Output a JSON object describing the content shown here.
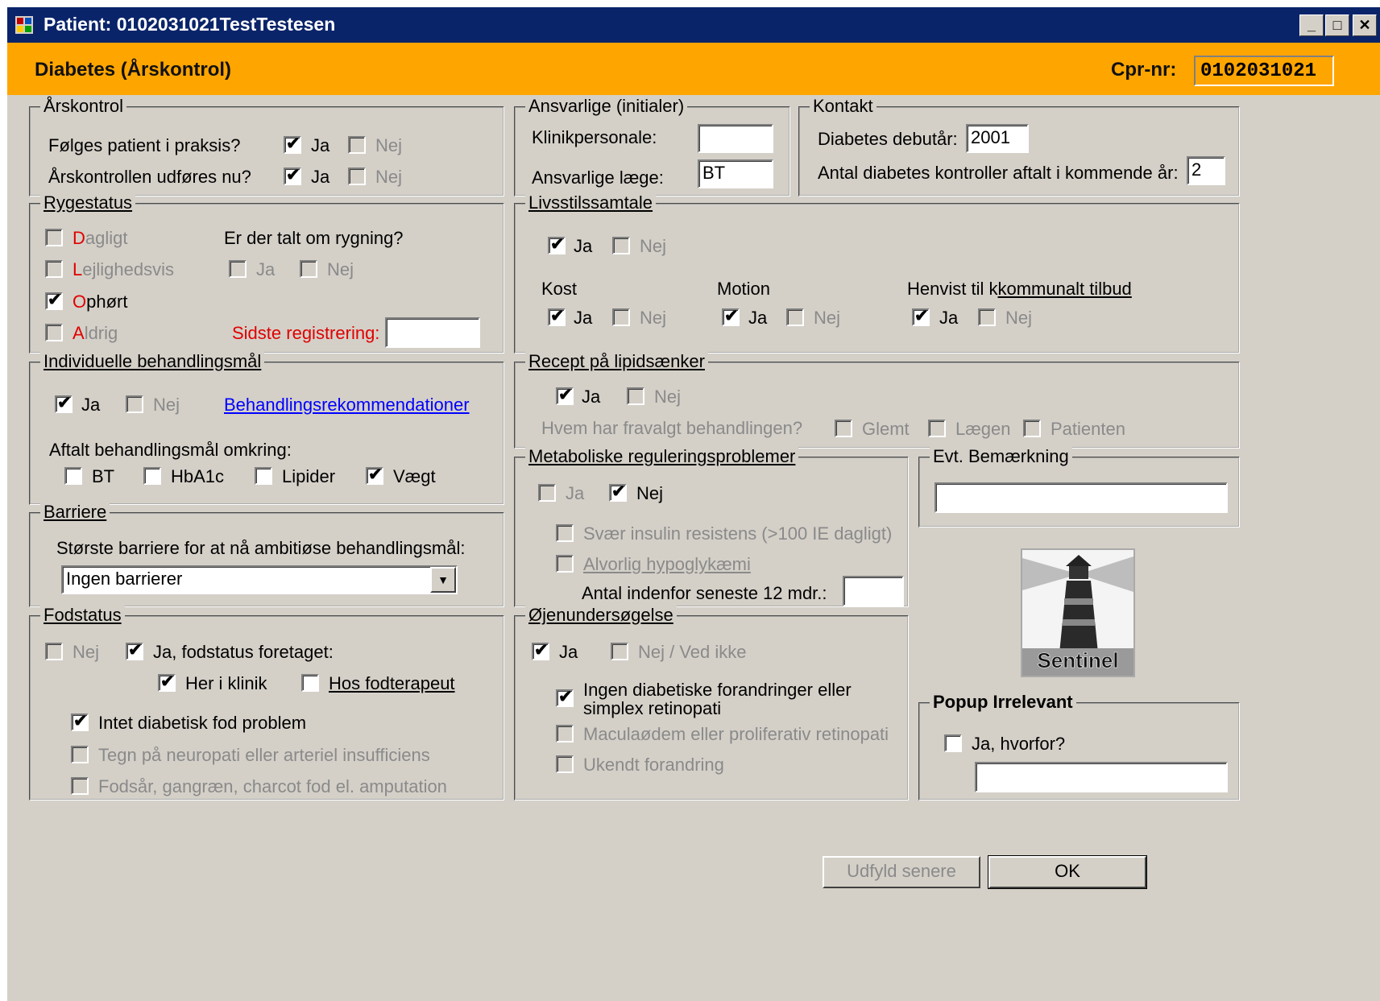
{
  "window": {
    "title": "Patient: 0102031021TestTestesen",
    "min_label": "_",
    "max_label": "□",
    "close_label": "✕"
  },
  "header": {
    "form_title": "Diabetes (Årskontrol)",
    "cpr_label": "Cpr-nr:",
    "cpr_value": "0102031021",
    "bg_color": "#ffa500"
  },
  "aarskontrol": {
    "legend": "Årskontrol",
    "q1": "Følges patient i praksis?",
    "q2": "Årskontrollen udføres nu?",
    "ja": "Ja",
    "nej": "Nej"
  },
  "ansvarlige": {
    "legend": "Ansvarlige (initialer)",
    "klinik_label": "Klinikpersonale:",
    "klinik_value": "",
    "laege_label": "Ansvarlige læge:",
    "laege_value": "BT"
  },
  "kontakt": {
    "legend": "Kontakt",
    "debut_label": "Diabetes debutår:",
    "debut_value": "2001",
    "antal_label": "Antal diabetes kontroller aftalt i kommende år:",
    "antal_value": "2"
  },
  "rygestatus": {
    "legend": "Rygestatus",
    "opt1_first": "D",
    "opt1_rest": "agligt",
    "opt2_first": "L",
    "opt2_rest": "ejlighedsvis",
    "opt3_first": "O",
    "opt3_rest": "phørt",
    "opt4_first": "A",
    "opt4_rest": "ldrig",
    "talt_label": "Er der talt om rygning?",
    "ja": "Ja",
    "nej": "Nej",
    "sidste_label": "Sidste registrering:",
    "sidste_value": ""
  },
  "livsstil": {
    "legend": "Livsstilssamtale",
    "ja": "Ja",
    "nej": "Nej",
    "kost": "Kost",
    "motion": "Motion",
    "henvist_prefix": "Henvist til k",
    "henvist_link": "kommunalt tilbud"
  },
  "behandling": {
    "legend": "Individuelle behandlingsmål",
    "ja": "Ja",
    "nej": "Nej",
    "link": "Behandlingsrekommendationer",
    "aftalt_label": "Aftalt behandlingsmål omkring:",
    "bt": "BT",
    "hba1c": "HbA1c",
    "lipider": "Lipider",
    "vaegt": "Vægt"
  },
  "recept": {
    "legend": "Recept på lipidsænker",
    "ja": "Ja",
    "nej": "Nej",
    "hvem_label": "Hvem har fravalgt behandlingen?",
    "glemt": "Glemt",
    "laegen": "Lægen",
    "patienten": "Patienten"
  },
  "barriere": {
    "legend": "Barriere",
    "label": "Største barriere for at nå ambitiøse behandlingsmål:",
    "selected": "Ingen barrierer"
  },
  "metabolisk": {
    "legend": "Metaboliske reguleringsproblemer",
    "ja": "Ja",
    "nej": "Nej",
    "insulin": "Svær insulin resistens (>100 IE dagligt)",
    "hypo": "Alvorlig hypoglykæmi",
    "antal_label": "Antal indenfor seneste 12 mdr.:",
    "antal_value": ""
  },
  "bemaerkning": {
    "legend": "Evt. Bemærkning",
    "value": ""
  },
  "fodstatus": {
    "legend": "Fodstatus",
    "nej": "Nej",
    "ja_foretaget": "Ja, fodstatus foretaget:",
    "her_klinik": "Her i klinik",
    "hos_fod": "Hos fodterapeut",
    "intet": "Intet diabetisk fod problem",
    "tegn": "Tegn på neuropati eller arteriel insufficiens",
    "fodsaar": "Fodsår, gangræn, charcot fod el. amputation"
  },
  "oeje": {
    "legend": "Øjenundersøgelse",
    "ja": "Ja",
    "nej": "Nej / Ved ikke",
    "ingen_line1": "Ingen diabetiske forandringer eller",
    "ingen_line2": "simplex retinopati",
    "macula": "Maculaødem eller proliferativ retinopati",
    "ukendt": "Ukendt forandring"
  },
  "logo": {
    "text": "Sentinel"
  },
  "popup": {
    "legend": "Popup Irrelevant",
    "ja_hvorfor": "Ja, hvorfor?",
    "value": ""
  },
  "buttons": {
    "later": "Udfyld senere",
    "ok": "OK"
  },
  "check": "✔"
}
